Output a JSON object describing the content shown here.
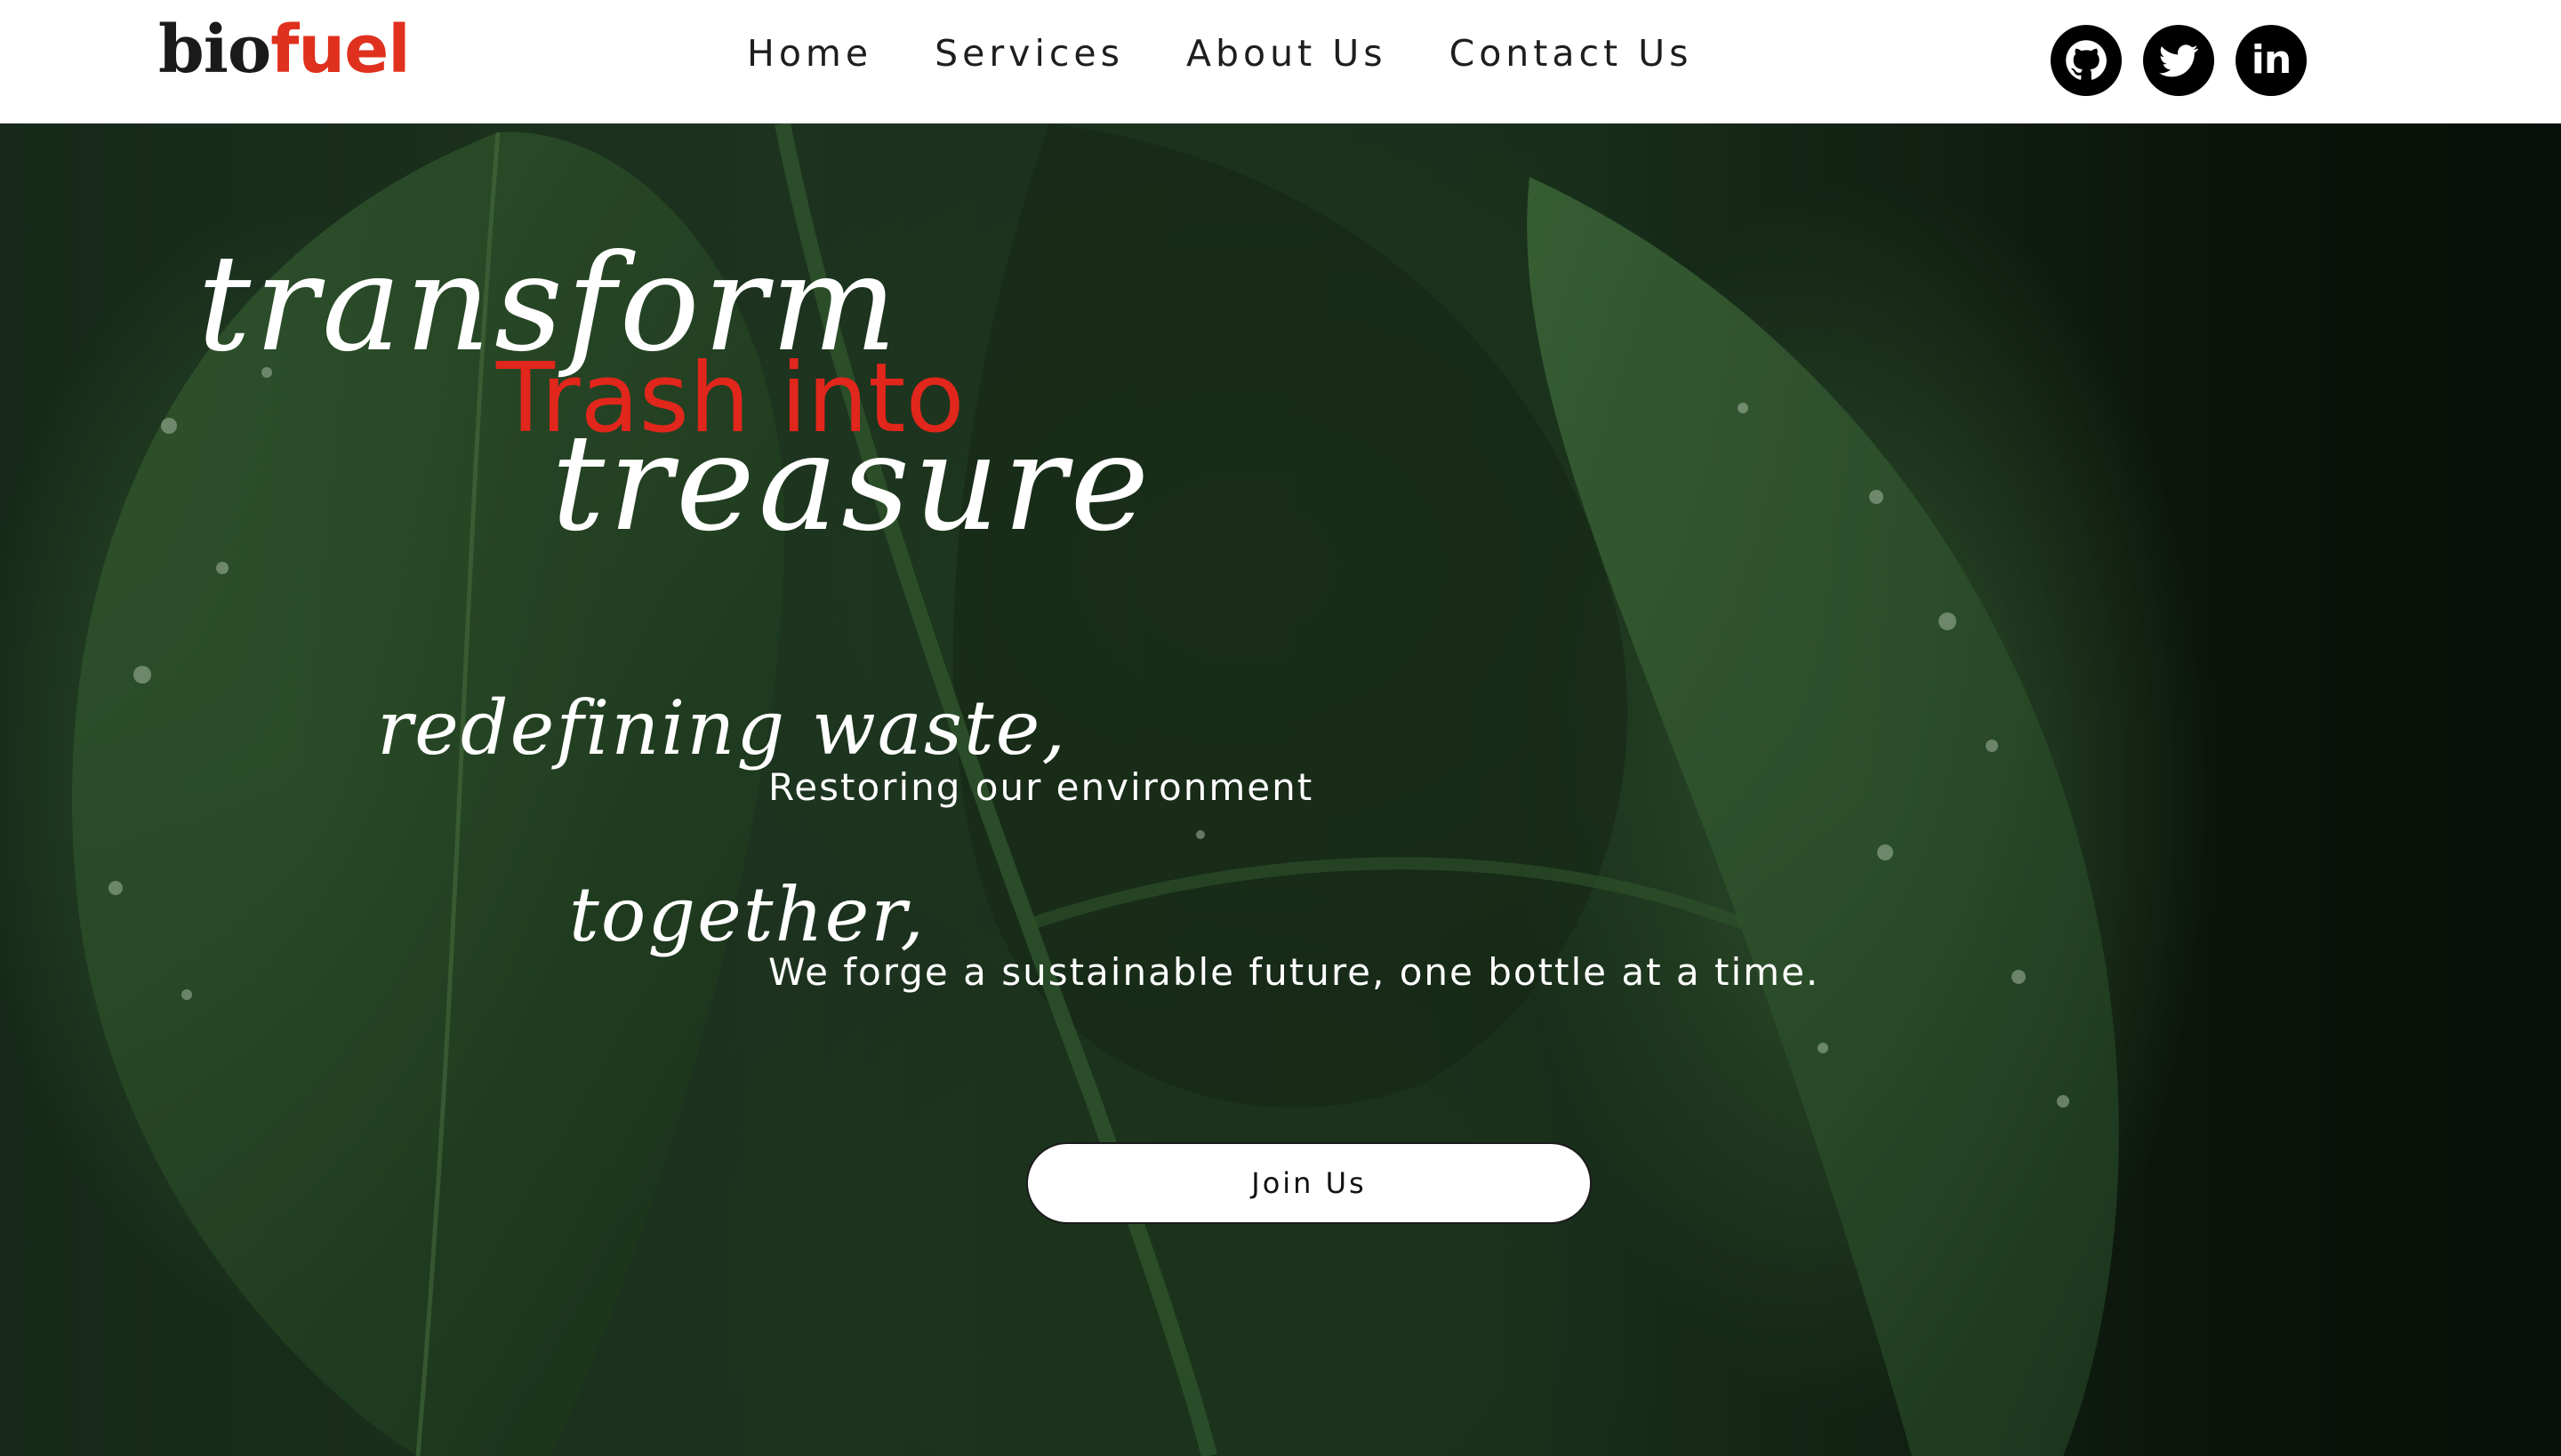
{
  "brand": {
    "logo_part1": "bio",
    "logo_part2": "fuel",
    "accent_color": "#e0301e"
  },
  "nav": {
    "items": [
      {
        "label": "Home"
      },
      {
        "label": "Services"
      },
      {
        "label": "About Us"
      },
      {
        "label": "Contact Us"
      }
    ]
  },
  "social": [
    {
      "icon": "github-icon"
    },
    {
      "icon": "twitter-icon"
    },
    {
      "icon": "linkedin-icon",
      "glyph": "in"
    }
  ],
  "hero": {
    "line1": "transform",
    "line2": "Trash into",
    "line3": "treasure",
    "tagline1_title": "redefining waste,",
    "tagline1_text": "Restoring our environment",
    "tagline2_title": "together,",
    "tagline2_text": "We forge a sustainable future, one bottle at a time.",
    "cta_label": "Join Us",
    "title_color": "#ffffff",
    "highlight_color": "#e1261c",
    "background_theme": "#1f3a22"
  }
}
